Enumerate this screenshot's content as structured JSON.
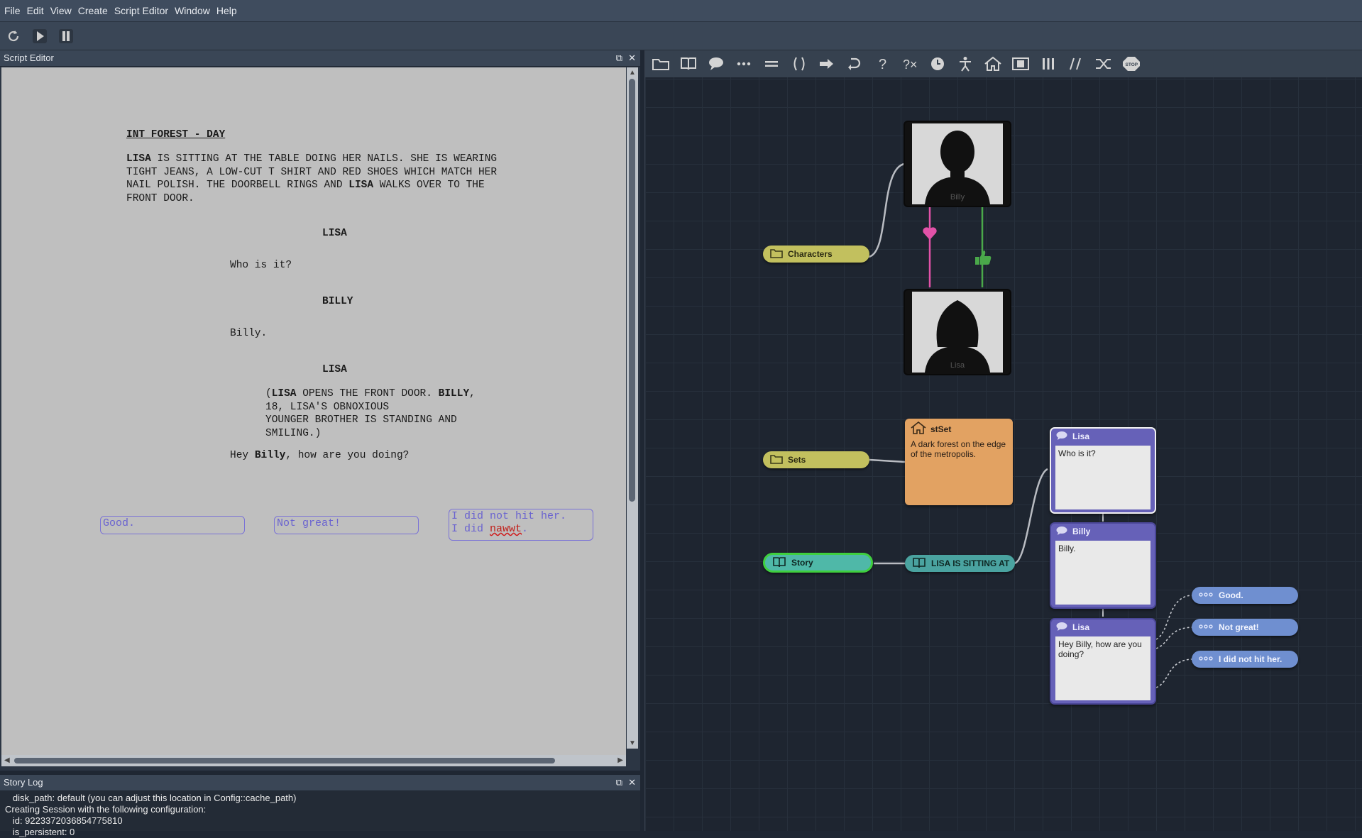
{
  "menu": [
    "File",
    "Edit",
    "View",
    "Create",
    "Script Editor",
    "Window",
    "Help"
  ],
  "toolbar_icons": [
    "refresh-icon",
    "play-icon",
    "pause-icon"
  ],
  "script_editor": {
    "title": "Script Editor",
    "scene_heading": "INT FOREST - DAY",
    "action_lines": [
      [
        {
          "t": "LISA",
          "b": true
        },
        {
          "t": " IS SITTING AT THE TABLE DOING HER NAILS. SHE IS WEARING"
        }
      ],
      [
        {
          "t": "TIGHT JEANS, A LOW-CUT T SHIRT AND RED SHOES WHICH MATCH HER"
        }
      ],
      [
        {
          "t": "NAIL POLISH. THE DOORBELL RINGS AND "
        },
        {
          "t": "LISA",
          "b": true
        },
        {
          "t": " WALKS OVER TO THE"
        }
      ],
      [
        {
          "t": "FRONT DOOR."
        }
      ]
    ],
    "char1": "LISA",
    "line1": "Who is it?",
    "char2": "BILLY",
    "line2": "Billy.",
    "char3": "LISA",
    "paren_lines": [
      [
        {
          "t": "("
        },
        {
          "t": "LISA",
          "b": true
        },
        {
          "t": " OPENS THE FRONT DOOR. "
        },
        {
          "t": "BILLY",
          "b": true
        },
        {
          "t": ","
        }
      ],
      [
        {
          "t": "18, LISA'S OBNOXIOUS"
        }
      ],
      [
        {
          "t": "YOUNGER BROTHER IS STANDING AND"
        }
      ],
      [
        {
          "t": "SMILING.)"
        }
      ]
    ],
    "line3_parts": [
      {
        "t": "Hey "
      },
      {
        "t": "Billy",
        "b": true
      },
      {
        "t": ", how are you doing?"
      }
    ],
    "choices": [
      "Good.",
      "Not great!"
    ],
    "choice3_line1": "I did not hit her.",
    "choice3_line2_pre": "I did ",
    "choice3_misspelled": "nawwt",
    "choice3_line2_post": "."
  },
  "story_log": {
    "title": "Story Log",
    "lines": [
      "   disk_path: default (you can adjust this location in Config::cache_path)",
      "Creating Session with the following configuration:",
      "   id: 9223372036854775810",
      "   is_persistent: 0"
    ]
  },
  "graph_toolbar_icons": [
    "folder-icon",
    "book-icon",
    "speech-bubble-icon",
    "ellipsis-icon",
    "equals-icon",
    "parentheses-icon",
    "arrow-right-icon",
    "loop-arrow-icon",
    "question-icon",
    "question-x-icon",
    "clock-icon",
    "person-icon",
    "home-icon",
    "film-icon",
    "columns-icon",
    "double-slash-icon",
    "shuffle-icon",
    "stop-icon"
  ],
  "graph": {
    "characters_label": "Characters",
    "billy_name": "Billy",
    "lisa_name": "Lisa",
    "sets_label": "Sets",
    "set_title": "stSet",
    "set_desc": "A dark forest on the edge of the metropolis.",
    "story_label": "Story",
    "scene_label": "LISA IS SITTING AT",
    "dialogs": [
      {
        "speaker": "Lisa",
        "text": "Who is it?"
      },
      {
        "speaker": "Billy",
        "text": "Billy."
      },
      {
        "speaker": "Lisa",
        "text": "Hey Billy, how are you doing?"
      }
    ],
    "choices": [
      "Good.",
      "Not great!",
      "I did not hit her."
    ]
  },
  "colors": {
    "characters_pill": "#c2c05e",
    "story_pill": "#4fb8a8",
    "story_border": "#3fcf3f",
    "scene_pill": "#4aa3a0",
    "set_node": "#e2a262",
    "dialog": "#6661b8",
    "choice": "#6f8fd0",
    "love_link": "#e252a8",
    "like_link": "#4aa84a"
  }
}
